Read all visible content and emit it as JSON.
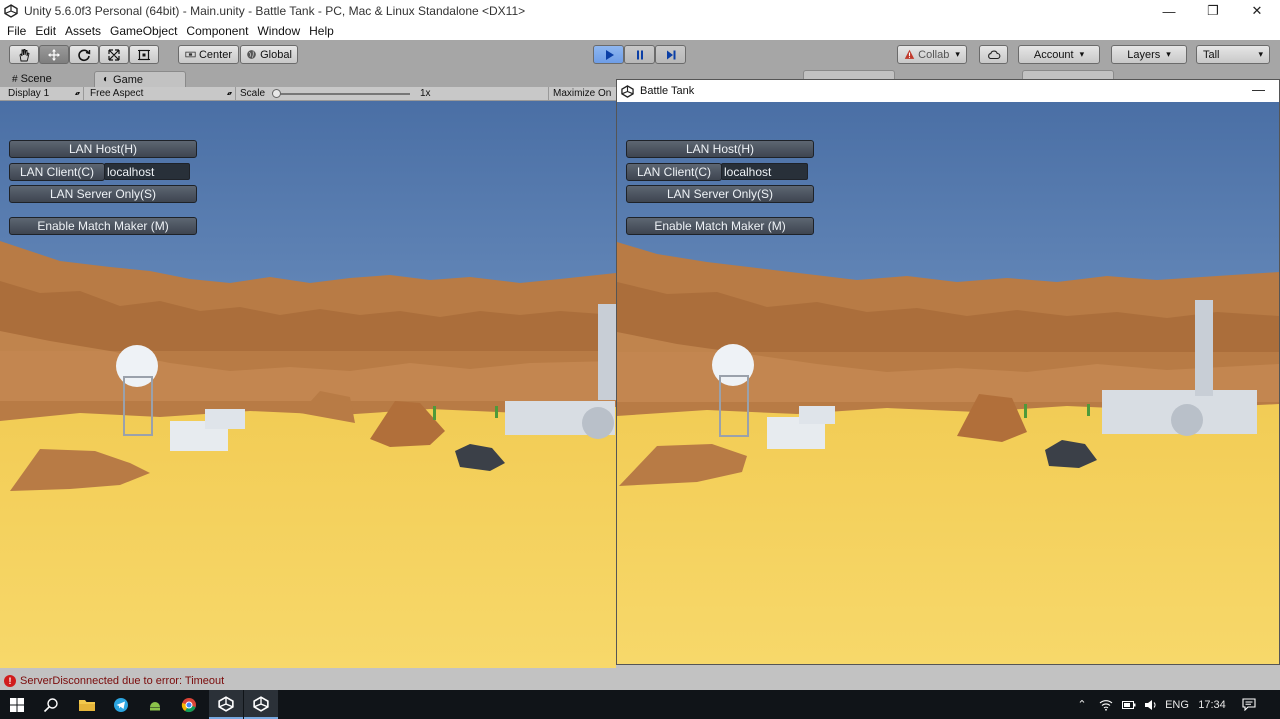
{
  "window": {
    "title": "Unity 5.6.0f3 Personal (64bit) - Main.unity - Battle Tank - PC, Mac & Linux Standalone <DX11>",
    "controls": [
      "—",
      "❐",
      "✕"
    ]
  },
  "menu": [
    "File",
    "Edit",
    "Assets",
    "GameObject",
    "Component",
    "Window",
    "Help"
  ],
  "toolbar": {
    "pivot_label": "Center",
    "space_label": "Global",
    "collab_label": "Collab",
    "account_label": "Account",
    "layers_label": "Layers",
    "layout_label": "Tall"
  },
  "tabs": {
    "scene": "Scene",
    "game": "Game"
  },
  "gamebar": {
    "display": "Display 1",
    "aspect": "Free Aspect",
    "scale_label": "Scale",
    "scale_value": "1x",
    "maximize": "Maximize On"
  },
  "gui": {
    "host": "LAN Host(H)",
    "client": "LAN Client(C)",
    "address": "localhost",
    "server": "LAN Server Only(S)",
    "matchmaker": "Enable Match Maker (M)"
  },
  "player": {
    "title": "Battle Tank",
    "minimize": "—"
  },
  "console": {
    "message": "ServerDisconnected due to error: Timeout"
  },
  "taskbar": {
    "lang": "ENG",
    "time": "17:34"
  },
  "colors": {
    "sky": "#4a6fa5",
    "sand": "#f5cf55",
    "rock": "#b87b45",
    "gui_button": "#4a525d",
    "error": "#d01c1c"
  }
}
